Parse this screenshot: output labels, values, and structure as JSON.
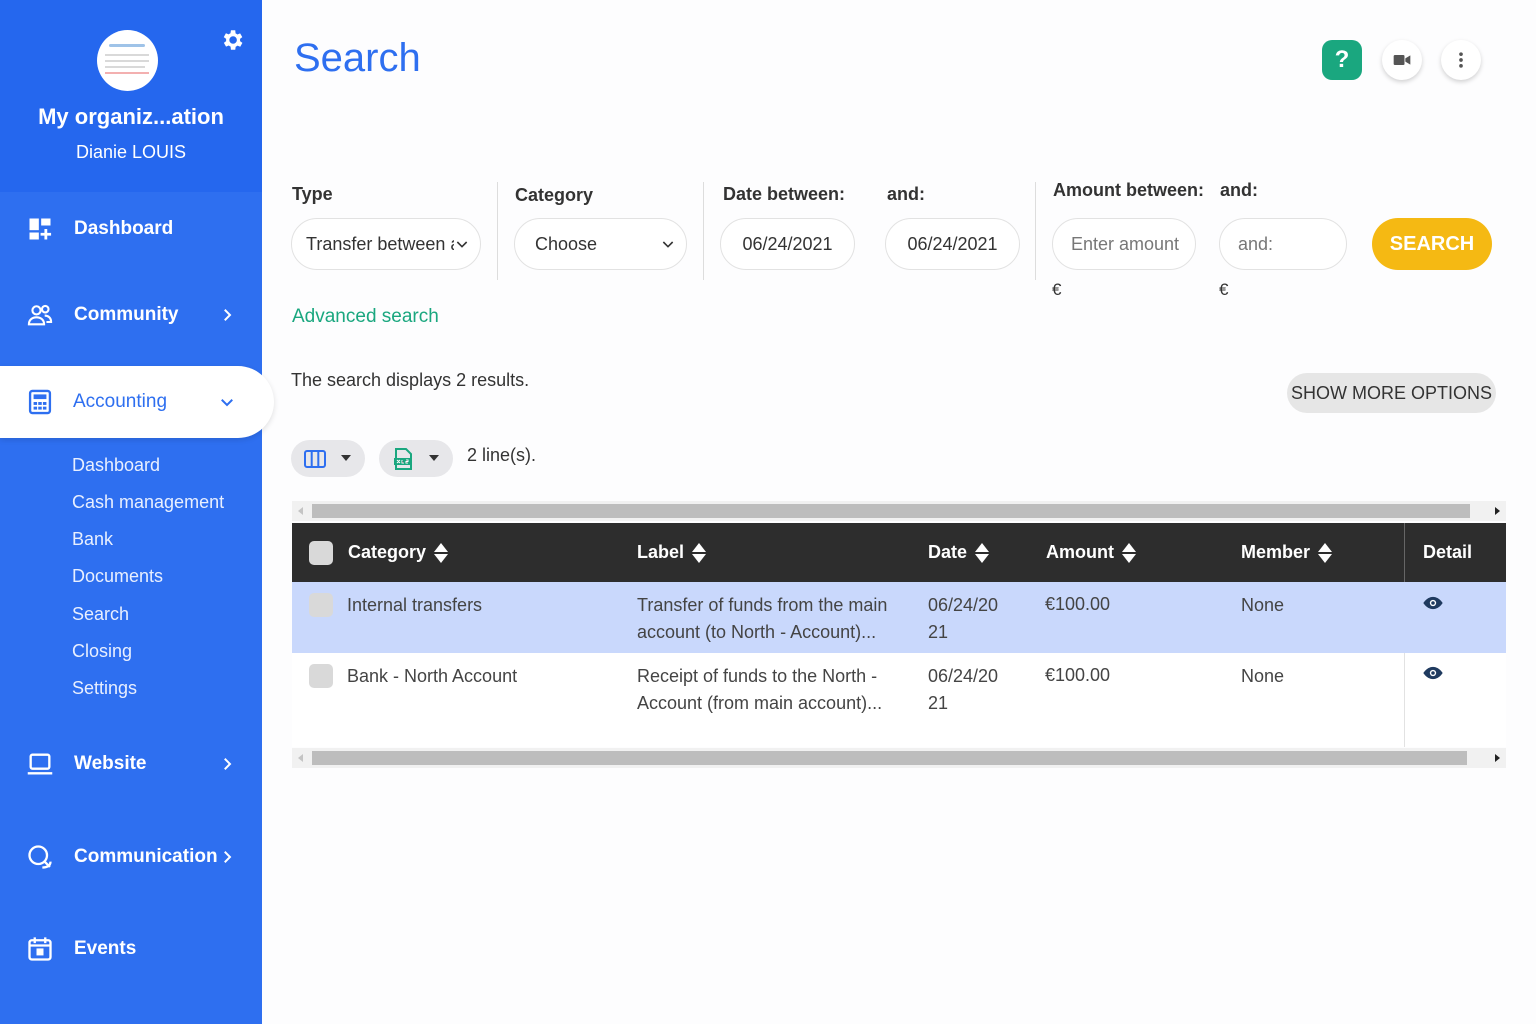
{
  "sidebar": {
    "org_name": "My organiz...ation",
    "user_name": "Dianie LOUIS",
    "nav": [
      {
        "label": "Dashboard"
      },
      {
        "label": "Community"
      },
      {
        "label": "Accounting"
      },
      {
        "label": "Website"
      },
      {
        "label": "Communication"
      },
      {
        "label": "Events"
      }
    ],
    "accounting_sub": [
      "Dashboard",
      "Cash management",
      "Bank",
      "Documents",
      "Search",
      "Closing",
      "Settings"
    ]
  },
  "header": {
    "title": "Search",
    "help_label": "?"
  },
  "filters": {
    "type_label": "Type",
    "type_value": "Transfer between ac",
    "category_label": "Category",
    "category_value": "Choose",
    "date_between_label": "Date between:",
    "date_from": "06/24/2021",
    "date_and_label": "and:",
    "date_to": "06/24/2021",
    "amount_between_label": "Amount between:",
    "amount_min_placeholder": "Enter amount",
    "amount_and_label": "and:",
    "amount_max_placeholder": "and:",
    "currency": "€",
    "search_button": "SEARCH",
    "advanced_link": "Advanced search"
  },
  "results": {
    "summary": "The search displays 2 results.",
    "more_options": "SHOW MORE OPTIONS",
    "lines_count": "2 line(s)."
  },
  "table": {
    "columns": [
      "Category",
      "Label",
      "Date",
      "Amount",
      "Member",
      "Detail"
    ],
    "rows": [
      {
        "category": "Internal transfers",
        "label_1": "Transfer of funds from the main",
        "label_2": "account (to North - Account)...",
        "date_1": "06/24/20",
        "date_2": "21",
        "amount": "€100.00",
        "member": "None"
      },
      {
        "category": "Bank - North Account",
        "label_1": "Receipt of funds to the North -",
        "label_2": "Account (from main account)...",
        "date_1": "06/24/20",
        "date_2": "21",
        "amount": "€100.00",
        "member": "None"
      }
    ]
  },
  "colors": {
    "brand": "#2e6ff0",
    "accent_green": "#1aa77f",
    "search_yellow": "#f5b913",
    "table_header": "#2d2d2d",
    "selected_row": "#c9d8fc"
  },
  "icons": [
    "gear-icon",
    "dashboard-icon",
    "community-icon",
    "calculator-icon",
    "laptop-icon",
    "chat-icon",
    "calendar-icon",
    "chevron-right-icon",
    "chevron-down-icon",
    "video-icon",
    "kebab-menu-icon",
    "columns-icon",
    "xls-icon",
    "eye-icon",
    "sort-icon"
  ]
}
